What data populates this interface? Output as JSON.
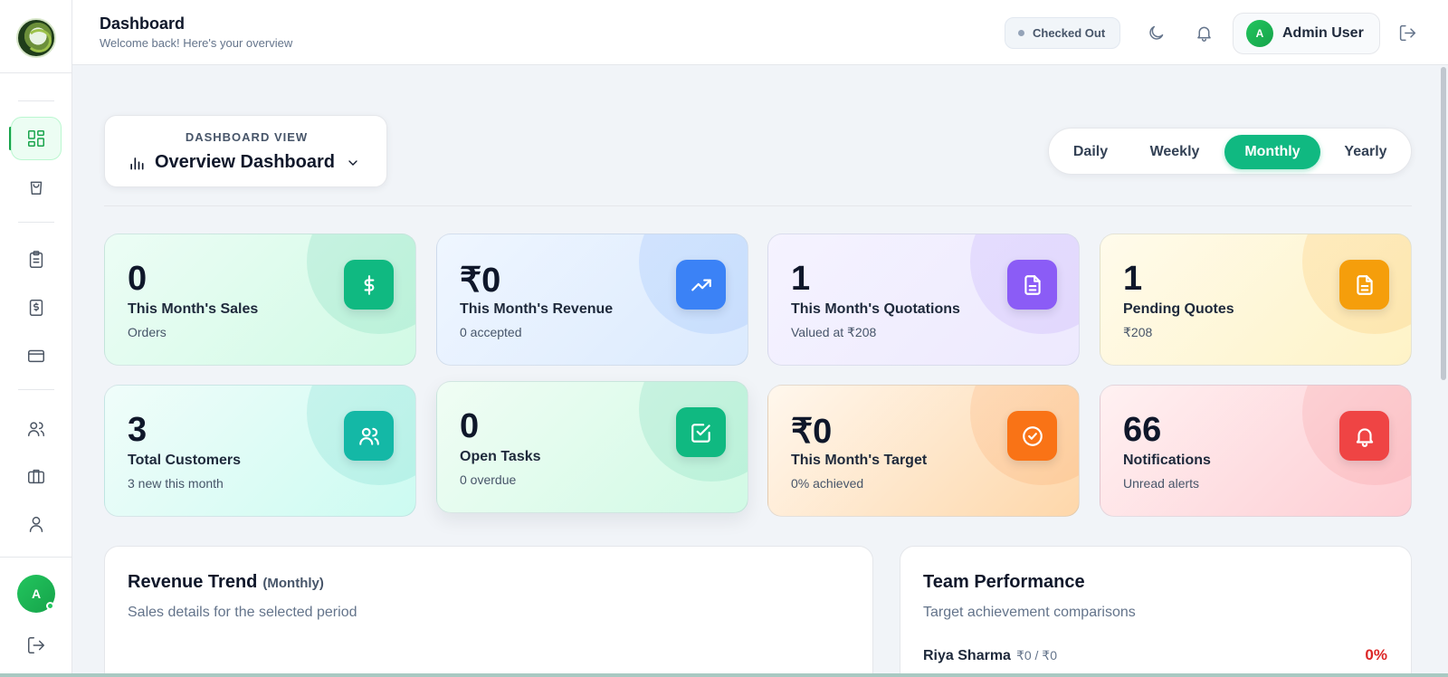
{
  "header": {
    "title": "Dashboard",
    "subtitle": "Welcome back! Here's your overview",
    "status": "Checked Out",
    "user_initial": "A",
    "user_name": "Admin User"
  },
  "sidebar": {
    "items": [
      {
        "name": "dashboard",
        "icon": "dashboard-grid-icon",
        "active": true
      },
      {
        "name": "shop",
        "icon": "shopping-bag-icon",
        "active": false
      },
      {
        "name": "tasks",
        "icon": "clipboard-list-icon",
        "active": false
      },
      {
        "name": "invoices",
        "icon": "invoice-dollar-icon",
        "active": false
      },
      {
        "name": "payments",
        "icon": "credit-card-icon",
        "active": false
      },
      {
        "name": "customers",
        "icon": "users-icon",
        "active": false
      },
      {
        "name": "briefcase",
        "icon": "briefcase-icon",
        "active": false
      },
      {
        "name": "profile",
        "icon": "user-icon",
        "active": false
      }
    ],
    "avatar_initial": "A"
  },
  "view_selector": {
    "label": "DASHBOARD VIEW",
    "title": "Overview Dashboard"
  },
  "period": {
    "options": [
      "Daily",
      "Weekly",
      "Monthly",
      "Yearly"
    ],
    "selected": "Monthly"
  },
  "stats": [
    {
      "value": "0",
      "label": "This Month's Sales",
      "sub": "Orders",
      "icon": "dollar-icon",
      "color": "#10b981"
    },
    {
      "value": "₹0",
      "label": "This Month's Revenue",
      "sub": "0 accepted",
      "icon": "trending-up-icon",
      "color": "#3b82f6"
    },
    {
      "value": "1",
      "label": "This Month's Quotations",
      "sub": "Valued at ₹208",
      "icon": "document-icon",
      "color": "#8b5cf6"
    },
    {
      "value": "1",
      "label": "Pending Quotes",
      "sub": "₹208",
      "icon": "document-icon",
      "color": "#f59e0b"
    },
    {
      "value": "3",
      "label": "Total Customers",
      "sub": "3 new this month",
      "icon": "users-icon",
      "color": "#14b8a6"
    },
    {
      "value": "0",
      "label": "Open Tasks",
      "sub": "0 overdue",
      "icon": "check-square-icon",
      "color": "#10b981"
    },
    {
      "value": "₹0",
      "label": "This Month's Target",
      "sub": "0% achieved",
      "icon": "check-circle-icon",
      "color": "#f97316"
    },
    {
      "value": "66",
      "label": "Notifications",
      "sub": "Unread alerts",
      "icon": "bell-icon",
      "color": "#ef4444"
    }
  ],
  "revenue_panel": {
    "title": "Revenue Trend",
    "tag": "(Monthly)",
    "subtitle": "Sales details for the selected period"
  },
  "team_panel": {
    "title": "Team Performance",
    "subtitle": "Target achievement comparisons",
    "members": [
      {
        "name": "Riya Sharma",
        "values": "₹0 / ₹0",
        "percent": "0%"
      }
    ]
  }
}
